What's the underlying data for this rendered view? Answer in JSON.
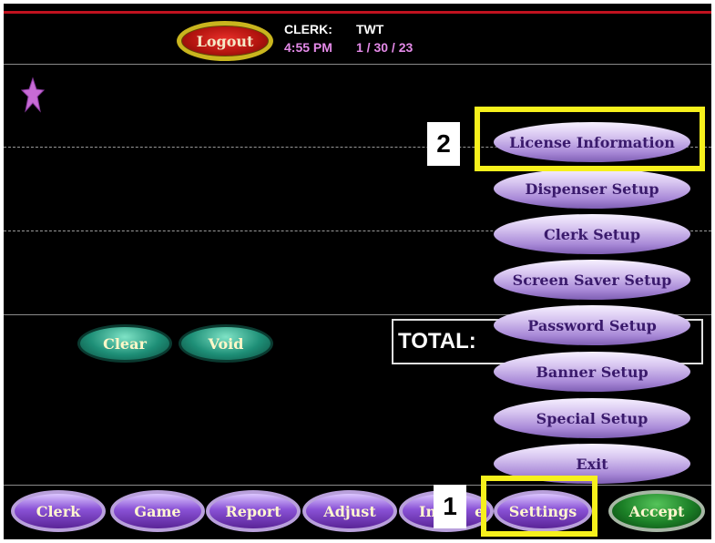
{
  "header": {
    "logout_label": "Logout",
    "clerk_label": "CLERK:",
    "clerk_value": "TWT",
    "time": "4:55 PM",
    "date": "1 / 30 / 23"
  },
  "menu": {
    "items": [
      "License Information",
      "Dispenser Setup",
      "Clerk Setup",
      "Screen Saver Setup",
      "Password Setup",
      "Banner Setup",
      "Special Setup",
      "Exit"
    ]
  },
  "actions": {
    "clear_label": "Clear",
    "void_label": "Void"
  },
  "total": {
    "label": "TOTAL:"
  },
  "bottom_bar": {
    "clerk": "Clerk",
    "game": "Game",
    "report": "Report",
    "adjust": "Adjust",
    "inventory_partial": "In",
    "inventory_tail": "e",
    "settings": "Settings",
    "accept": "Accept"
  },
  "annotations": {
    "step1": "1",
    "step2": "2",
    "highlight_color": "#f6f01c"
  },
  "colors": {
    "background": "#000000",
    "accent_line": "#c1121f",
    "menu_text": "#3a1a6c",
    "time_text": "#e48ae8"
  },
  "icons": {
    "star": "star-icon"
  }
}
